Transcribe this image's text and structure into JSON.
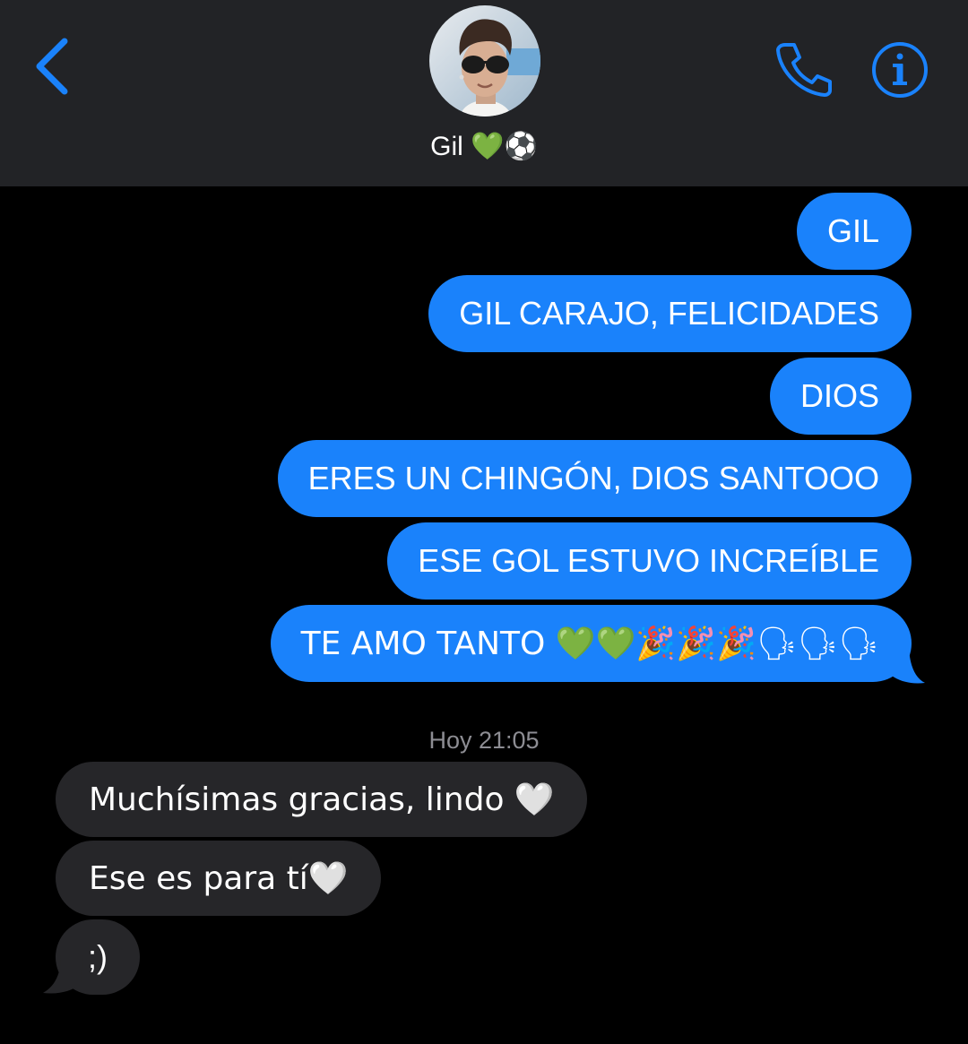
{
  "header": {
    "contact_name": "Gil 💚⚽",
    "back_icon": "chevron-left-icon",
    "call_icon": "phone-icon",
    "info_icon": "info-icon",
    "accent_color": "#1a82fb",
    "background_color": "#222326"
  },
  "messages_outgoing": [
    {
      "text": "GIL"
    },
    {
      "text": "GIL CARAJO, FELICIDADES"
    },
    {
      "text": "DIOS"
    },
    {
      "text": "ERES UN CHINGÓN, DIOS SANTOOO"
    },
    {
      "text": "ESE GOL ESTUVO INCREÍBLE"
    },
    {
      "text": "TE AMO TANTO 💚💚🎉🎉🎉🗣🗣🗣"
    }
  ],
  "timestamp": "Hoy 21:05",
  "messages_incoming": [
    {
      "text": "Muchísimas gracias, lindo 🤍"
    },
    {
      "text": "Ese es para tí🤍"
    },
    {
      "text": ";)"
    }
  ],
  "colors": {
    "outgoing_bubble": "#1a82fb",
    "incoming_bubble": "#262629",
    "timestamp": "#8d8d93"
  }
}
